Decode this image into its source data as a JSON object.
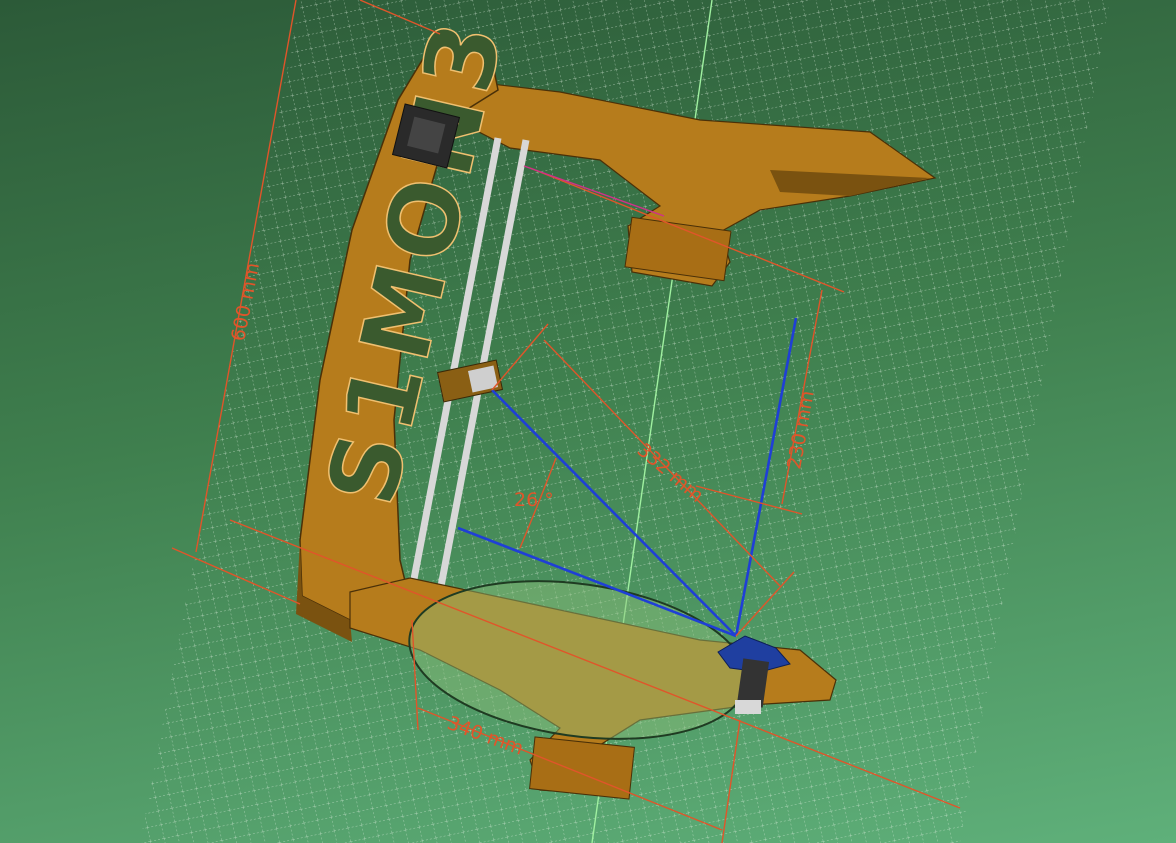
{
  "colors": {
    "background_top": "#2c5a38",
    "background_bottom": "#5fb07a",
    "wood": "#b67c1c",
    "wood_dark": "#7a5210",
    "dimension": "#e0552a",
    "arm": "#1f3fd6",
    "grid": "#dfeee0",
    "axis_green": "#9ff0a0"
  },
  "frame": {
    "logo": "S1MON3",
    "motor": "stepper-motor"
  },
  "dimensions": {
    "height": "600 mm",
    "bed_diameter": "340 mm",
    "vertical_reach": "230 mm",
    "horizontal_reach": "332 mm",
    "angle": "26 °"
  }
}
